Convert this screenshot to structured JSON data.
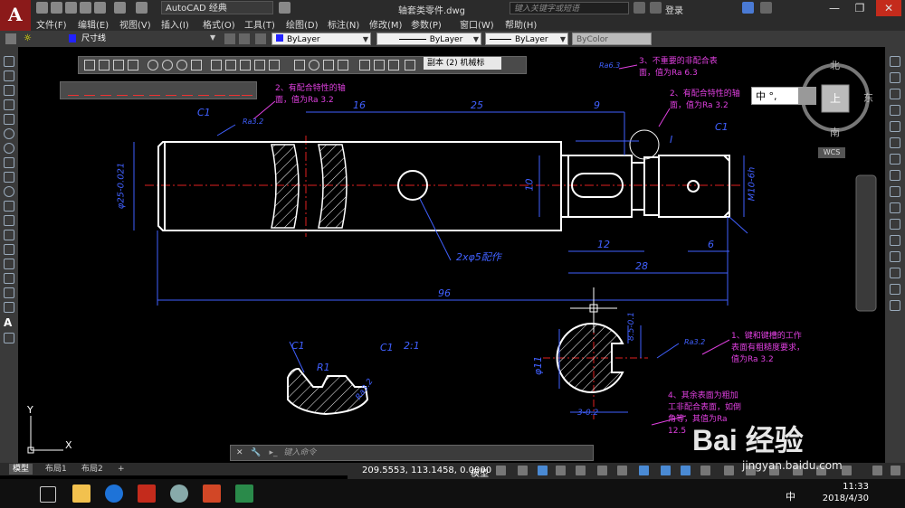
{
  "app": {
    "logo_letter": "A",
    "workspace": "AutoCAD 经典",
    "doc_title": "轴套类零件.dwg",
    "search_placeholder": "键入关键字或短语",
    "login": "登录"
  },
  "menu": [
    "文件(F)",
    "编辑(E)",
    "视图(V)",
    "插入(I)",
    "格式(O)",
    "工具(T)",
    "绘图(D)",
    "标注(N)",
    "修改(M)",
    "参数(P)",
    "窗口(W)",
    "帮助(H)"
  ],
  "properties": {
    "dimstyle": "尺寸线",
    "color": "ByLayer",
    "linetype": "ByLayer",
    "lineweight": "ByLayer",
    "plotstyle": "ByColor"
  },
  "dim_toolbar_combo": "副本 (2) 机械标",
  "notes": {
    "note_right_top": [
      "3、不重要的非配合表",
      "面，值为Ra 6.3"
    ],
    "note_left": [
      "2、有配合特性的轴",
      "面，值为Ra 3.2"
    ],
    "note_right_mid": [
      "2、有配合特性的轴",
      "面，值为Ra 3.2"
    ],
    "note_keyway": [
      "1、键和键槽的工作",
      "表面有粗糙度要求，",
      "值为Ra 3.2"
    ],
    "note_rest": [
      "4、其余表面为粗加",
      "工非配合表面，如倒",
      "角等，其值为Ra",
      "12.5"
    ]
  },
  "dims": {
    "d16": "16",
    "d25": "25",
    "d9": "9",
    "d12": "12",
    "d6": "6",
    "d28": "28",
    "d96": "96",
    "d10": "10",
    "phi25": "φ25-0.021",
    "m10": "M10-6h",
    "hole": "2xφ5配作",
    "c1_a": "C1",
    "c1_b": "C1",
    "c1_c": "C1",
    "c1_d": "C1",
    "phi11": "φ11",
    "r1": "R1",
    "ra": "Ra3.2",
    "ra_b": "Ra3.2",
    "ra_c": "Ra6.3",
    "d21": "2:1",
    "label_i": "I",
    "keyw": "3-0.2",
    "key_h": "8.5-0.1"
  },
  "viewcube": {
    "north": "北",
    "east": "东",
    "south": "南",
    "top": "上",
    "wcs": "WCS"
  },
  "ime": "中 °,",
  "command_placeholder": "键入命令",
  "layout_tabs": [
    "模型",
    "布局1",
    "布局2",
    "+"
  ],
  "status": {
    "coords": "209.5553, 113.1458, 0.0000",
    "model": "模型"
  },
  "ucs": {
    "x": "X",
    "y": "Y"
  },
  "taskbar": {
    "time": "11:33",
    "date": "2018/4/30",
    "ime": "中"
  },
  "watermark": {
    "brand": "Bai 经验",
    "sub": "jingyan.baidu.com"
  },
  "colors": {
    "accent": "#8b1a1a",
    "dim": "#4060ff",
    "note": "#e040e0",
    "center": "#e02020",
    "geometry": "#ffffff"
  }
}
